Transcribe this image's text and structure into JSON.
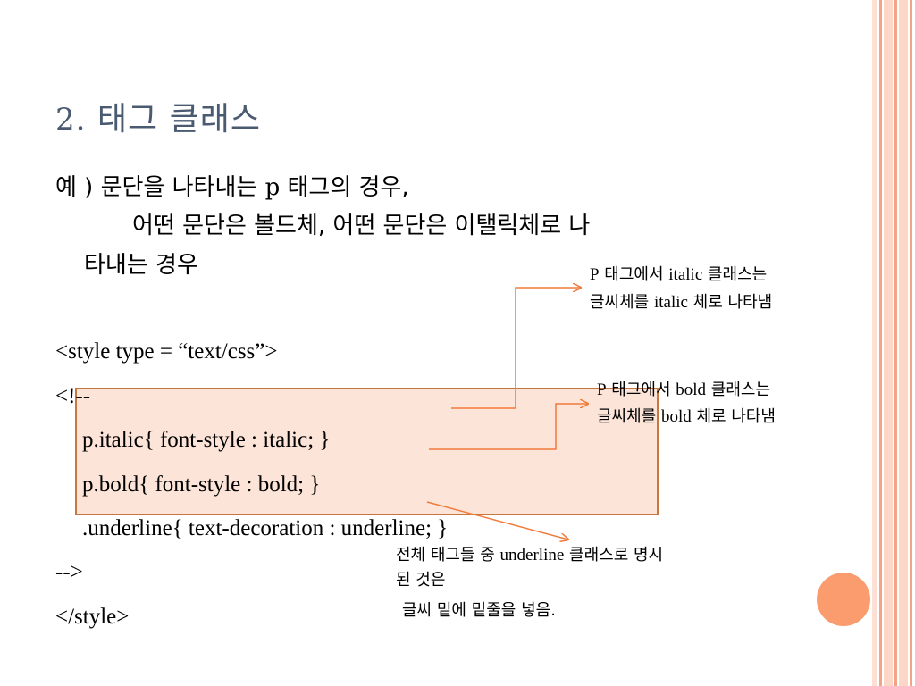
{
  "slide": {
    "title_number": "2.",
    "title_text": "태그 클래스",
    "intro_line1_a": "예 ) 문단을 나타내는 ",
    "intro_line1_b": "p",
    "intro_line1_c": " 태그의 경우,",
    "intro_line2": "어떤 문단은 볼드체, 어떤 문단은 이탤릭체로 나",
    "intro_line3": "타내는 경우",
    "code": [
      "<style type = “text/css”>",
      "<!--",
      "p.italic{ font-style : italic; }",
      "p.bold{ font-style : bold; }",
      ".underline{ text-decoration : underline; }",
      "-->",
      "</style>"
    ],
    "notes": {
      "italic_1a": "P",
      "italic_1b": " 태그에서 ",
      "italic_1c": "italic",
      "italic_1d": " 클래스는",
      "italic_2a": "글씨체를 ",
      "italic_2b": "italic",
      "italic_2c": " 체로 나타냄",
      "bold_1a": "P",
      "bold_1b": " 태그에서 ",
      "bold_1c": "bold",
      "bold_1d": " 클래스는",
      "bold_2a": "글씨체를 ",
      "bold_2b": "bold",
      "bold_2c": " 체로 나타냄",
      "underline_1a": "전체 태그들 중 ",
      "underline_1b": "underline",
      "underline_1c": " 클래스로 명시",
      "underline_2": "된 것은",
      "underline_3": "글씨 밑에 밑줄을 넣음."
    }
  },
  "colors": {
    "title": "#4a5a70",
    "highlight_fill": "#fde4d9",
    "highlight_border": "#c8783e",
    "arrow": "#f07a3a",
    "orb": "#fb9c6e",
    "stripe_light": "#fcd6c6",
    "stripe_accent": "#f29a7a"
  }
}
